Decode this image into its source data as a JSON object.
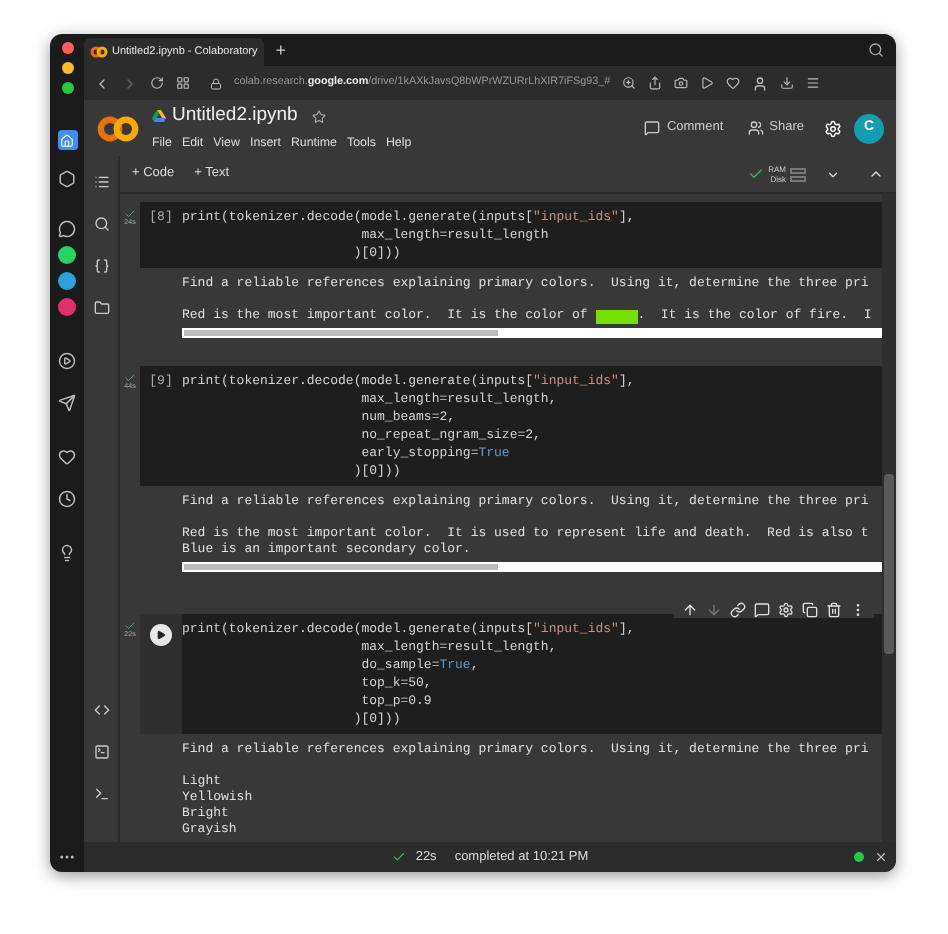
{
  "browser": {
    "tab_title": "Untitled2.ipynb - Colaboratory",
    "new_tab": "+",
    "url_host": "colab.research.",
    "url_domain": "google.com",
    "url_path": "/drive/1kAXkJavsQ8bWPrWZURrLhXIR7iFSg93_#"
  },
  "header": {
    "title": "Untitled2.ipynb",
    "menu": [
      "File",
      "Edit",
      "View",
      "Insert",
      "Runtime",
      "Tools",
      "Help"
    ],
    "comment": "Comment",
    "share": "Share",
    "avatar": "C"
  },
  "toolbar": {
    "add_code": "+ Code",
    "add_text": "+ Text",
    "ram": "RAM",
    "disk": "Disk"
  },
  "cells": [
    {
      "selected": false,
      "count": "[8]",
      "time": "24s",
      "code": [
        [
          {
            "kind": "plain",
            "text": "print(tokenizer.decode(model.generate(inputs["
          },
          {
            "kind": "string",
            "text": "\"input_ids\""
          },
          {
            "kind": "plain",
            "text": "],"
          }
        ],
        [
          {
            "kind": "plain",
            "text": "                       max_length=result_length"
          }
        ],
        [
          {
            "kind": "plain",
            "text": "                      )[0]))"
          }
        ]
      ],
      "output": [
        [
          [
            {
              "kind": "text",
              "text": "Find a reliable references explaining primary colors.  Using it, determine the three pri"
            }
          ]
        ],
        [
          [
            {
              "kind": "text",
              "text": "Red is the most important color.  It is the color of "
            },
            {
              "kind": "swatch",
              "color": "#76e000"
            },
            {
              "kind": "text",
              "text": ".  It is the color of fire.  I"
            }
          ]
        ]
      ]
    },
    {
      "selected": false,
      "count": "[9]",
      "time": "44s",
      "code": [
        [
          {
            "kind": "plain",
            "text": "print(tokenizer.decode(model.generate(inputs["
          },
          {
            "kind": "string",
            "text": "\"input_ids\""
          },
          {
            "kind": "plain",
            "text": "],"
          }
        ],
        [
          {
            "kind": "plain",
            "text": "                       max_length=result_length,"
          }
        ],
        [
          {
            "kind": "plain",
            "text": "                       num_beams=2,"
          }
        ],
        [
          {
            "kind": "plain",
            "text": "                       no_repeat_ngram_size=2,"
          }
        ],
        [
          {
            "kind": "plain",
            "text": "                       early_stopping="
          },
          {
            "kind": "keyword",
            "text": "True"
          }
        ],
        [
          {
            "kind": "plain",
            "text": "                      )[0]))"
          }
        ]
      ],
      "output": [
        [
          [
            {
              "kind": "text",
              "text": "Find a reliable references explaining primary colors.  Using it, determine the three pri"
            }
          ]
        ],
        [
          [
            {
              "kind": "text",
              "text": "Red is the most important color.  It is used to represent life and death.  Red is also t"
            }
          ],
          [
            {
              "kind": "text",
              "text": "Blue is an important secondary color."
            }
          ]
        ]
      ]
    },
    {
      "selected": true,
      "time": "22s",
      "code": [
        [
          {
            "kind": "plain",
            "text": "print(tokenizer.decode(model.generate(inputs["
          },
          {
            "kind": "string",
            "text": "\"input_ids\""
          },
          {
            "kind": "plain",
            "text": "],"
          }
        ],
        [
          {
            "kind": "plain",
            "text": "                       max_length=result_length,"
          }
        ],
        [
          {
            "kind": "plain",
            "text": "                       do_sample="
          },
          {
            "kind": "keyword",
            "text": "True"
          },
          {
            "kind": "plain",
            "text": ","
          }
        ],
        [
          {
            "kind": "plain",
            "text": "                       top_k=50,"
          }
        ],
        [
          {
            "kind": "plain",
            "text": "                       top_p=0.9"
          }
        ],
        [
          {
            "kind": "plain",
            "text": "                      )[0]))"
          }
        ]
      ],
      "output": [
        [
          [
            {
              "kind": "text",
              "text": "Find a reliable references explaining primary colors.  Using it, determine the three pri"
            }
          ]
        ],
        [
          [
            {
              "kind": "text",
              "text": "Light"
            }
          ],
          [
            {
              "kind": "text",
              "text": "Yellowish"
            }
          ],
          [
            {
              "kind": "text",
              "text": "Bright"
            }
          ],
          [
            {
              "kind": "text",
              "text": "Grayish"
            }
          ]
        ]
      ]
    }
  ],
  "status": {
    "time": "22s",
    "message": "completed at 10:21 PM"
  }
}
